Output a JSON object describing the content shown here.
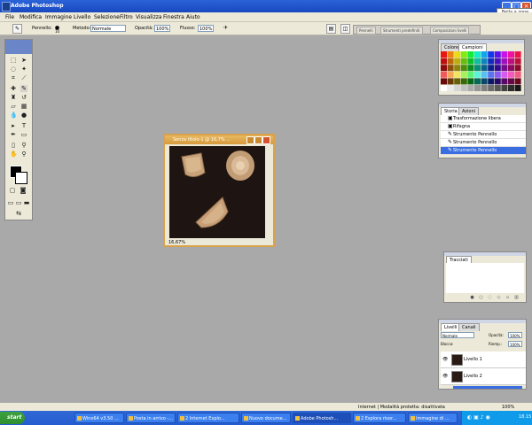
{
  "window": {
    "title": "Adobe Photoshop",
    "tip": "Bella a zone"
  },
  "menu": [
    "File",
    "Modifica",
    "Immagine",
    "Livello",
    "Selezione",
    "Filtro",
    "Visualizza",
    "Finestra",
    "Aiuto"
  ],
  "options_bar": {
    "brush_label": "Pennello:",
    "brush_size": "10",
    "mode_label": "Metodo:",
    "mode_value": "Normale",
    "opacity_label": "Opacità:",
    "opacity_value": "100%",
    "flow_label": "Flusso:",
    "flow_value": "100%",
    "palette_well_tabs": [
      "Pennelli",
      "Strumenti predefiniti",
      "Composizioni livelli"
    ]
  },
  "document": {
    "title": "Senza titolo-1 @ 16,7% ...",
    "zoom": "16,67%"
  },
  "color_panel": {
    "tabs": [
      "Colore",
      "Campioni"
    ]
  },
  "history_panel": {
    "tabs": [
      "Storia",
      "Azioni"
    ],
    "items": [
      "Trasformazione libera",
      "Rifagna",
      "Strumento Pennello",
      "Strumento Pennello",
      "Strumento Pennello"
    ],
    "selected_index": 4
  },
  "paths_panel": {
    "tabs": [
      "Tracciati"
    ]
  },
  "layers_panel": {
    "tabs": [
      "Livelli",
      "Canali"
    ],
    "blend_mode": "Normale",
    "opacity_label": "Opacità:",
    "opacity_value": "100%",
    "lock_label": "Blocca:",
    "fill_label": "Riemp.:",
    "fill_value": "100%",
    "layers": [
      {
        "name": "Livello 1",
        "selected": false
      },
      {
        "name": "Livello 2",
        "selected": true
      }
    ]
  },
  "statusbar": {
    "text": "Internet | Modalità protetta: disattivata",
    "zoom": "100%"
  },
  "taskbar": {
    "start": "start",
    "tasks": [
      "Winx64 v3.50 ...",
      "Posta in arrivo -...",
      "2 Internet Explo...",
      "Nuovo docume...",
      "Adobe Photosh...",
      "2 Esplora risor...",
      "Immagine di ..."
    ],
    "active_index": 4,
    "clock": "18.15"
  },
  "colors": {
    "workspace": "#a9a9a9",
    "titlebar": "#245dd1",
    "selection": "#3a6ee0"
  }
}
